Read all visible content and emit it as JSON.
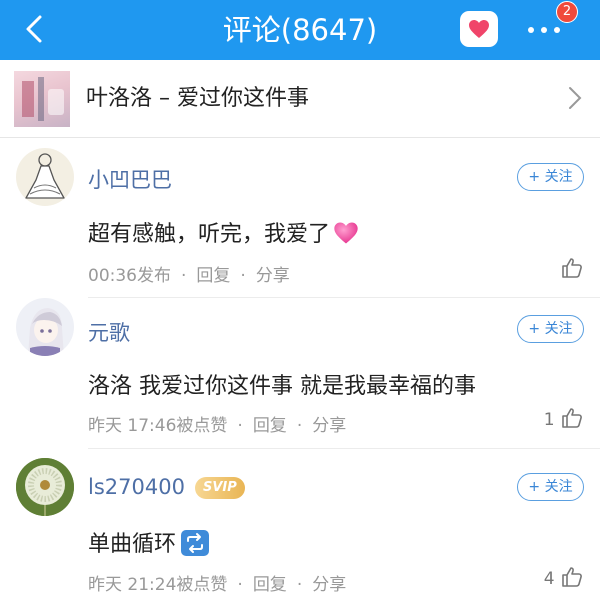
{
  "header": {
    "title": "评论(8647)",
    "badge_count": "2",
    "back_icon": "back-arrow-icon",
    "heart_icon": "heart-icon",
    "more_icon": "more-dots-icon",
    "bar_color": "#1f98f0",
    "badge_color": "#f04a3b"
  },
  "song": {
    "title": "叶洛洛 – 爱过你这件事"
  },
  "comments": [
    {
      "username": "小凹巴巴",
      "follow_label": "+ 关注",
      "text": "超有感触，听完，我爱了",
      "time": "00:36发布",
      "reply_label": "回复",
      "share_label": "分享",
      "like_count": "",
      "emoji": "pink-heart-emoji"
    },
    {
      "username": "元歌",
      "follow_label": "+ 关注",
      "text": "洛洛 我爱过你这件事 就是我最幸福的事",
      "time": "昨天 17:46被点赞",
      "reply_label": "回复",
      "share_label": "分享",
      "like_count": "1"
    },
    {
      "username": "ls270400",
      "vip_badge": "SVIP",
      "follow_label": "+ 关注",
      "text": "单曲循环",
      "time": "昨天 21:24被点赞",
      "reply_label": "回复",
      "share_label": "分享",
      "like_count": "4",
      "emoji": "repeat-emoji"
    }
  ],
  "meta_separator": "·",
  "colors": {
    "username": "#4e6fa6",
    "follow": "#3a86d6",
    "svip": "#e9b554"
  }
}
